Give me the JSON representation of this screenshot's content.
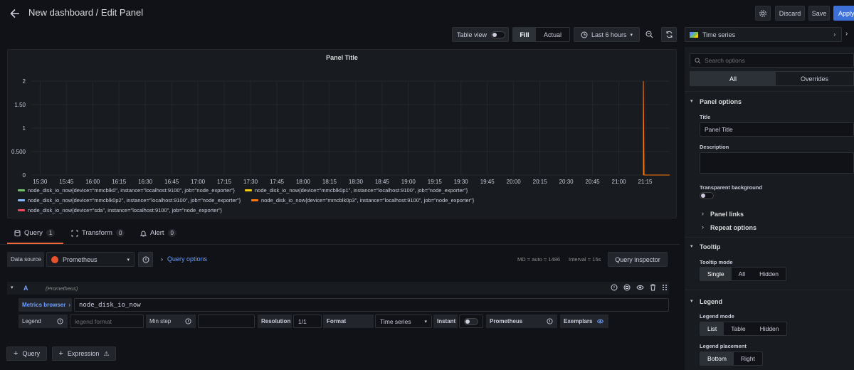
{
  "header": {
    "title": "New dashboard / Edit Panel",
    "discard": "Discard",
    "save": "Save",
    "apply": "Apply"
  },
  "toolbar": {
    "table_view": "Table view",
    "fill": "Fill",
    "actual": "Actual",
    "time_range": "Last 6 hours"
  },
  "viz_picker": {
    "label": "Time series"
  },
  "panel": {
    "title": "Panel Title"
  },
  "chart_data": {
    "type": "line",
    "title": "Panel Title",
    "xlabel": "",
    "ylabel": "",
    "x": [
      "15:30",
      "15:45",
      "16:00",
      "16:15",
      "16:30",
      "16:45",
      "17:00",
      "17:15",
      "17:30",
      "17:45",
      "18:00",
      "18:15",
      "18:30",
      "18:45",
      "19:00",
      "19:15",
      "19:30",
      "19:45",
      "20:00",
      "20:15",
      "20:30",
      "20:45",
      "21:00",
      "21:15"
    ],
    "yticks": [
      "2",
      "1.50",
      "1",
      "0.500",
      "0"
    ],
    "ylim": [
      0,
      2
    ],
    "grid": true,
    "legend_placement": "bottom",
    "series": [
      {
        "name": "node_disk_io_now{device=\"mmcblk0\", instance=\"localhost:9100\", job=\"node_exporter\"}",
        "color": "#73bf69",
        "values": []
      },
      {
        "name": "node_disk_io_now{device=\"mmcblk0p1\", instance=\"localhost:9100\", job=\"node_exporter\"}",
        "color": "#f2cc0c",
        "values": []
      },
      {
        "name": "node_disk_io_now{device=\"mmcblk0p2\", instance=\"localhost:9100\", job=\"node_exporter\"}",
        "color": "#8ab8ff",
        "values": []
      },
      {
        "name": "node_disk_io_now{device=\"mmcblk0p3\", instance=\"localhost:9100\", job=\"node_exporter\"}",
        "color": "#ff780a",
        "values": []
      },
      {
        "name": "node_disk_io_now{device=\"sda\", instance=\"localhost:9100\", job=\"node_exporter\"}",
        "color": "#f2495c",
        "values": []
      }
    ],
    "spike": {
      "x": "21:14",
      "value": 2
    }
  },
  "query_tabs": [
    {
      "label": "Query",
      "count": "1"
    },
    {
      "label": "Transform",
      "count": "0"
    },
    {
      "label": "Alert",
      "count": "0"
    }
  ],
  "datasource": {
    "label": "Data source",
    "value": "Prometheus",
    "query_options": "Query options",
    "md": "MD = auto = 1486",
    "interval": "Interval = 15s",
    "inspector": "Query inspector"
  },
  "query": {
    "ref": "A",
    "source": "(Prometheus)",
    "metrics_browser": "Metrics browser",
    "expr": "node_disk_io_now",
    "legend_label": "Legend",
    "legend_placeholder": "legend format",
    "min_step_label": "Min step",
    "resolution_label": "Resolution",
    "resolution_value": "1/1",
    "format_label": "Format",
    "format_value": "Time series",
    "instant_label": "Instant",
    "prometheus_label": "Prometheus",
    "exemplars_label": "Exemplars"
  },
  "add": {
    "query": "Query",
    "expression": "Expression"
  },
  "options": {
    "search_placeholder": "Search options",
    "tab_all": "All",
    "tab_overrides": "Overrides",
    "panel_options": "Panel options",
    "title_label": "Title",
    "title_value": "Panel Title",
    "description_label": "Description",
    "transparent_label": "Transparent background",
    "panel_links": "Panel links",
    "repeat_options": "Repeat options",
    "tooltip": "Tooltip",
    "tooltip_mode_label": "Tooltip mode",
    "tooltip_modes": [
      "Single",
      "All",
      "Hidden"
    ],
    "legend": "Legend",
    "legend_mode_label": "Legend mode",
    "legend_modes": [
      "List",
      "Table",
      "Hidden"
    ],
    "legend_placement_label": "Legend placement",
    "legend_placements": [
      "Bottom",
      "Right"
    ]
  }
}
